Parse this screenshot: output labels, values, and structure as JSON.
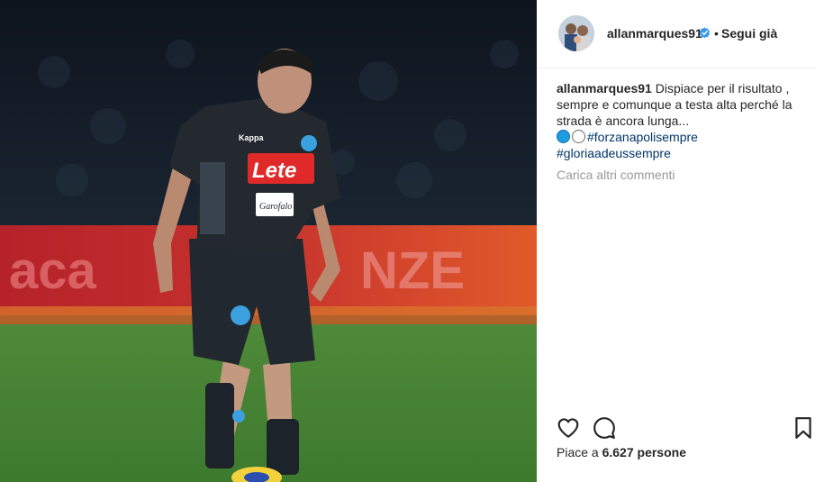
{
  "post": {
    "image_alt": "Calciatore in maglia scura durante una partita",
    "sponsor_text": "Lete",
    "sponsor_sub": "Garofalo",
    "shirt_brand": "Kappa"
  },
  "header": {
    "username": "allanmarques91",
    "separator": "•",
    "follow_label": "Segui già"
  },
  "caption": {
    "username": "allanmarques91",
    "text": "Dispiace per il risultato , sempre e comunque a testa alta perché la strada è ancora lunga...",
    "hashtag_1": "#forzanapolisempre",
    "hashtag_2": "#gloriaadeussempre"
  },
  "comments": {
    "load_more_label": "Carica altri commenti"
  },
  "likes": {
    "prefix": "Piace a ",
    "count": "6.627 persone"
  },
  "colors": {
    "link": "#003569",
    "muted": "#999999",
    "verified": "#3897f0",
    "text": "#262626"
  },
  "icons": [
    "heart-icon",
    "comment-icon",
    "bookmark-icon",
    "verified-badge-icon"
  ]
}
